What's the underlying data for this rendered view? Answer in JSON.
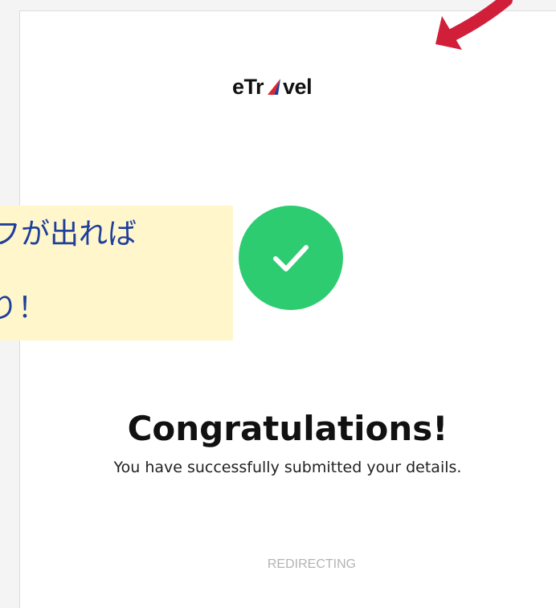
{
  "brand": {
    "logo_left": "eTr",
    "logo_right": "vel",
    "colors": {
      "red": "#e0252b",
      "blue": "#1c3f94",
      "green": "#2ecc71"
    }
  },
  "status": {
    "icon": "check-icon",
    "title": "Congratulations!",
    "message": "You have successfully submitted your details.",
    "redirect_label": "REDIRECTING"
  },
  "annotation": {
    "line1": "フが出れば",
    "line2": "り！",
    "arrow_icon": "arrow-down-left-icon",
    "colors": {
      "note_bg": "#fff6cc",
      "note_text": "#1e3f9a",
      "arrow": "#d11f3a"
    }
  }
}
